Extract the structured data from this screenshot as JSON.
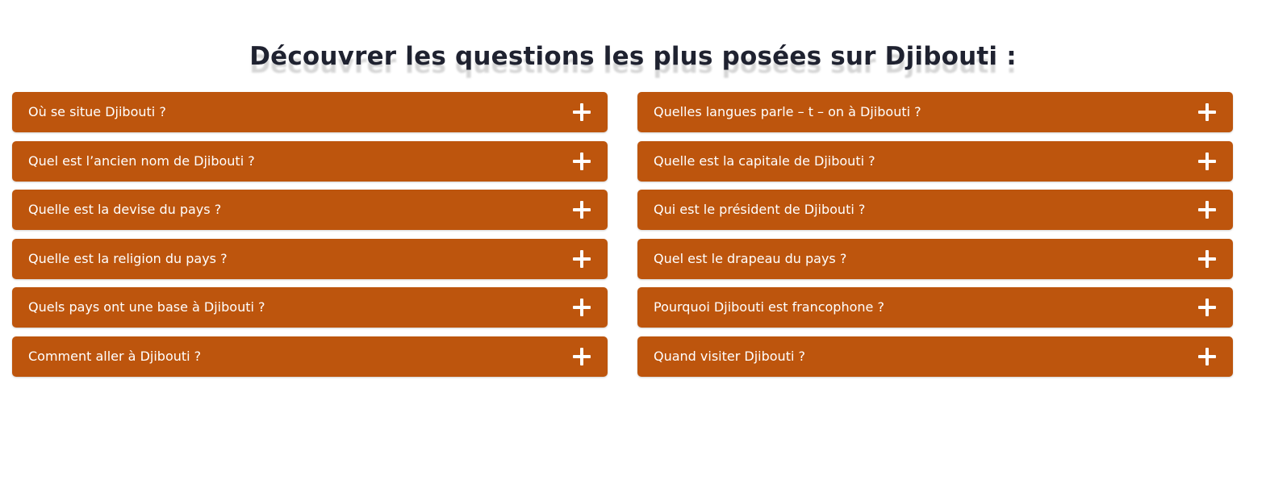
{
  "heading": "Découvrer les questions les plus posées sur Djibouti :",
  "colors": {
    "accent": "#bd550d",
    "text_on_accent": "#ffffff",
    "heading": "#1f2230"
  },
  "faq": {
    "left": [
      {
        "question": "Où se situe Djibouti ?",
        "icon": "plus-icon"
      },
      {
        "question": "Quel est l’ancien nom de Djibouti ?",
        "icon": "plus-icon"
      },
      {
        "question": "Quelle est la devise du pays ?",
        "icon": "plus-icon"
      },
      {
        "question": "Quelle est la religion du pays ?",
        "icon": "plus-icon"
      },
      {
        "question": "Quels pays ont une base à Djibouti ?",
        "icon": "plus-icon"
      },
      {
        "question": "Comment aller à Djibouti ?",
        "icon": "plus-icon"
      }
    ],
    "right": [
      {
        "question": "Quelles langues parle – t – on à Djibouti ?",
        "icon": "plus-icon"
      },
      {
        "question": "Quelle est la capitale de Djibouti ?",
        "icon": "plus-icon"
      },
      {
        "question": "Qui est le président de Djibouti ?",
        "icon": "plus-icon"
      },
      {
        "question": "Quel est le drapeau du pays ?",
        "icon": "plus-icon"
      },
      {
        "question": "Pourquoi Djibouti est francophone ?",
        "icon": "plus-icon"
      },
      {
        "question": "Quand visiter Djibouti ?",
        "icon": "plus-icon"
      }
    ]
  }
}
